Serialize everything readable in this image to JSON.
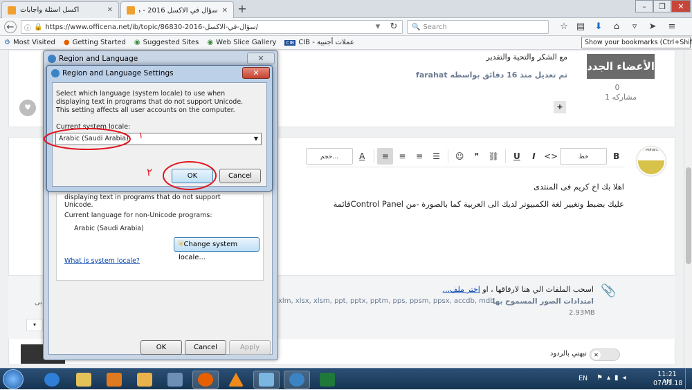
{
  "browser": {
    "tabs": [
      {
        "label": "اكسل اسئلة واجابات",
        "active": false
      },
      {
        "label": "سؤال في الاكسل 2016 - منتدى الاكـ...",
        "active": true
      }
    ],
    "new_tab": "+",
    "url": "https://www.officena.net/ib/topic/86830-2016-سؤال-في-الاكسل/",
    "search_placeholder": "Search",
    "bookmarks": [
      "Most Visited",
      "Getting Started",
      "Suggested Sites",
      "Web Slice Gallery",
      "CIB - عملات أجنبية"
    ],
    "bookmark_badge": "CIB",
    "tooltip": "Show your bookmarks (Ctrl+Shift+B)"
  },
  "post": {
    "thanks": "مع الشكر والتحية والتقدير",
    "edited": "تم تعديل منذ 16 دقائق بواسطه farahat",
    "author_badge": "الأعضاء الجدد",
    "reputation": "0",
    "posts": "1 مشاركه",
    "plus": "+"
  },
  "editor": {
    "font_select": "خط",
    "style_select": "حجم...",
    "line1": "اهلا بك اخ كريم فى المنتدى",
    "line2": "عليك بضبط وتغيير لغة الكمبيوتر لديك الى العربية كما بالصورة -من Control Panelقائمة",
    "attach_text": "اسحب الملفات الي هنا لارفاقها ، او",
    "attach_link": "اختر ملف...",
    "attach_ext_label": "امتدادات الصور المسموح بها",
    "attach_ext": "xlm, xlsx, xlsm, ppt, pptx, pptm, pps, ppsm, ppsx, accdb, mdb, mpp, 7z",
    "attach_size": "2.93MB",
    "notify": "نبهني بالردود",
    "submit_fragment": "رد",
    "avatar_text": "Ali Mohamed",
    "left_fragment": "بى"
  },
  "dialog_back": {
    "title": "Region and Language",
    "partial_text": "displaying text in programs that do not support Unicode.",
    "current_label": "Current language for non-Unicode programs:",
    "current_value": "Arabic (Saudi Arabia)",
    "change_button": "Change system locale...",
    "link": "What is system locale?",
    "ok": "OK",
    "cancel": "Cancel",
    "apply": "Apply"
  },
  "dialog_front": {
    "title": "Region and Language Settings",
    "description": "Select which language (system locale) to use when displaying text in programs that do not support Unicode. This setting affects all user accounts on the computer.",
    "locale_label": "Current system locale:",
    "locale_value": "Arabic (Saudi Arabia)",
    "ok": "OK",
    "cancel": "Cancel",
    "annotation_1": "١",
    "annotation_2": "٢"
  },
  "taskbar": {
    "lang": "EN",
    "time": "11:21 AM",
    "date": "07.11.18"
  },
  "colors": {
    "annotation": "#e0161e",
    "taskbar": "#1f3f61",
    "link": "#0645ad"
  }
}
